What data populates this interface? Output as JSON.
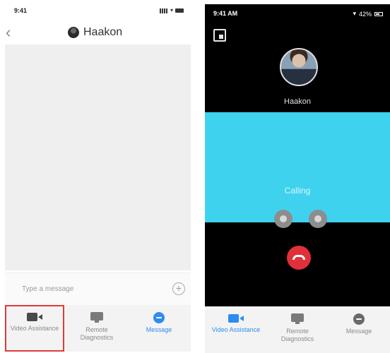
{
  "left": {
    "status": {
      "time": "9:41"
    },
    "header": {
      "title": "Haakon"
    },
    "input": {
      "placeholder": "Type a message"
    },
    "tabs": [
      {
        "label": "Video Assistance",
        "icon": "video-camera-icon"
      },
      {
        "label": "Remote Diagnostics",
        "icon": "monitor-icon"
      },
      {
        "label": "Message",
        "icon": "message-bubble-icon"
      }
    ]
  },
  "right": {
    "status": {
      "time": "9:41 AM",
      "battery": "42%"
    },
    "caller": {
      "name": "Haakon"
    },
    "call_status": "Calling",
    "tabs": [
      {
        "label": "Video Assistance",
        "icon": "video-camera-icon"
      },
      {
        "label": "Remote Diagnostics",
        "icon": "monitor-icon"
      },
      {
        "label": "Message",
        "icon": "message-bubble-icon"
      }
    ]
  },
  "colors": {
    "accent_blue": "#2d8cf0",
    "video_area": "#3fd2ee",
    "hangup_red": "#e0303a",
    "highlight_red": "#e03a3a"
  }
}
